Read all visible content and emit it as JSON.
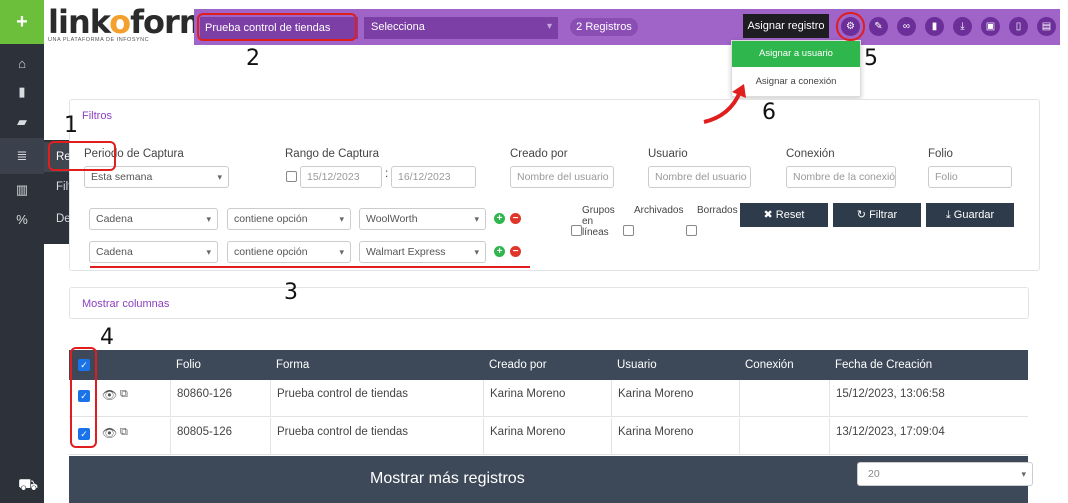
{
  "app": {
    "logo_text_a": "link",
    "logo_text_o": "o",
    "logo_text_b": "form",
    "logo_sub": "UNA PLATAFORMA DE INFOSYNC"
  },
  "topbar": {
    "form_name": "Prueba control de tiendas",
    "select_placeholder": "Selecciona",
    "registros_count": "2 Registros",
    "assign_label": "Asignar registro",
    "icons": [
      "gear-icon",
      "pencil-icon",
      "binoculars-icon",
      "file-icon",
      "download-icon",
      "archive-icon",
      "columns-icon",
      "trash-icon"
    ]
  },
  "dropdown": {
    "item1": "Asignar a usuario",
    "item2": "Asignar a conexión"
  },
  "sidebar": {
    "submenu": [
      "Registros",
      "Filtros",
      "Descargas"
    ]
  },
  "filters": {
    "title": "Filtros",
    "periodo_label": "Periodo de Captura",
    "periodo_value": "Esta semana",
    "rango_label": "Rango de Captura",
    "date_from": "15/12/2023",
    "date_to": "16/12/2023",
    "date_sep": ":",
    "creado_label": "Creado por",
    "creado_placeholder": "Nombre del usuario",
    "usuario_label": "Usuario",
    "usuario_placeholder": "Nombre del usuario",
    "conexion_label": "Conexión",
    "conexion_placeholder": "Nombre de la conexión",
    "folio_label": "Folio",
    "folio_placeholder": "Folio",
    "rows": [
      {
        "field": "Cadena",
        "op": "contiene opción",
        "value": "WoolWorth"
      },
      {
        "field": "Cadena",
        "op": "contiene opción",
        "value": "Walmart Express"
      }
    ],
    "grupos_label": "Grupos en líneas",
    "archivados_label": "Archivados",
    "borrados_label": "Borrados",
    "reset_label": "✖ Reset",
    "filtrar_label": "Filtrar",
    "guardar_label": "Guardar"
  },
  "columns_panel": {
    "title": "Mostrar columnas"
  },
  "table": {
    "headers": [
      "Folio",
      "Forma",
      "Creado por",
      "Usuario",
      "Conexión",
      "Fecha de Creación"
    ],
    "rows": [
      {
        "folio": "80860-126",
        "forma": "Prueba control de tiendas",
        "creado": "Karina Moreno",
        "usuario": "Karina Moreno",
        "conexion": "",
        "fecha": "15/12/2023, 13:06:58"
      },
      {
        "folio": "80805-126",
        "forma": "Prueba control de tiendas",
        "creado": "Karina Moreno",
        "usuario": "Karina Moreno",
        "conexion": "",
        "fecha": "13/12/2023, 17:09:04"
      }
    ],
    "more_label": "Mostrar más registros",
    "per_page": "20"
  },
  "annotations": {
    "n1": "1",
    "n2": "2",
    "n3": "3",
    "n4": "4",
    "n5": "5",
    "n6": "6"
  },
  "colors": {
    "accent": "#a063c7",
    "annotation_red": "#e01e1e",
    "green": "#2fb64d"
  }
}
